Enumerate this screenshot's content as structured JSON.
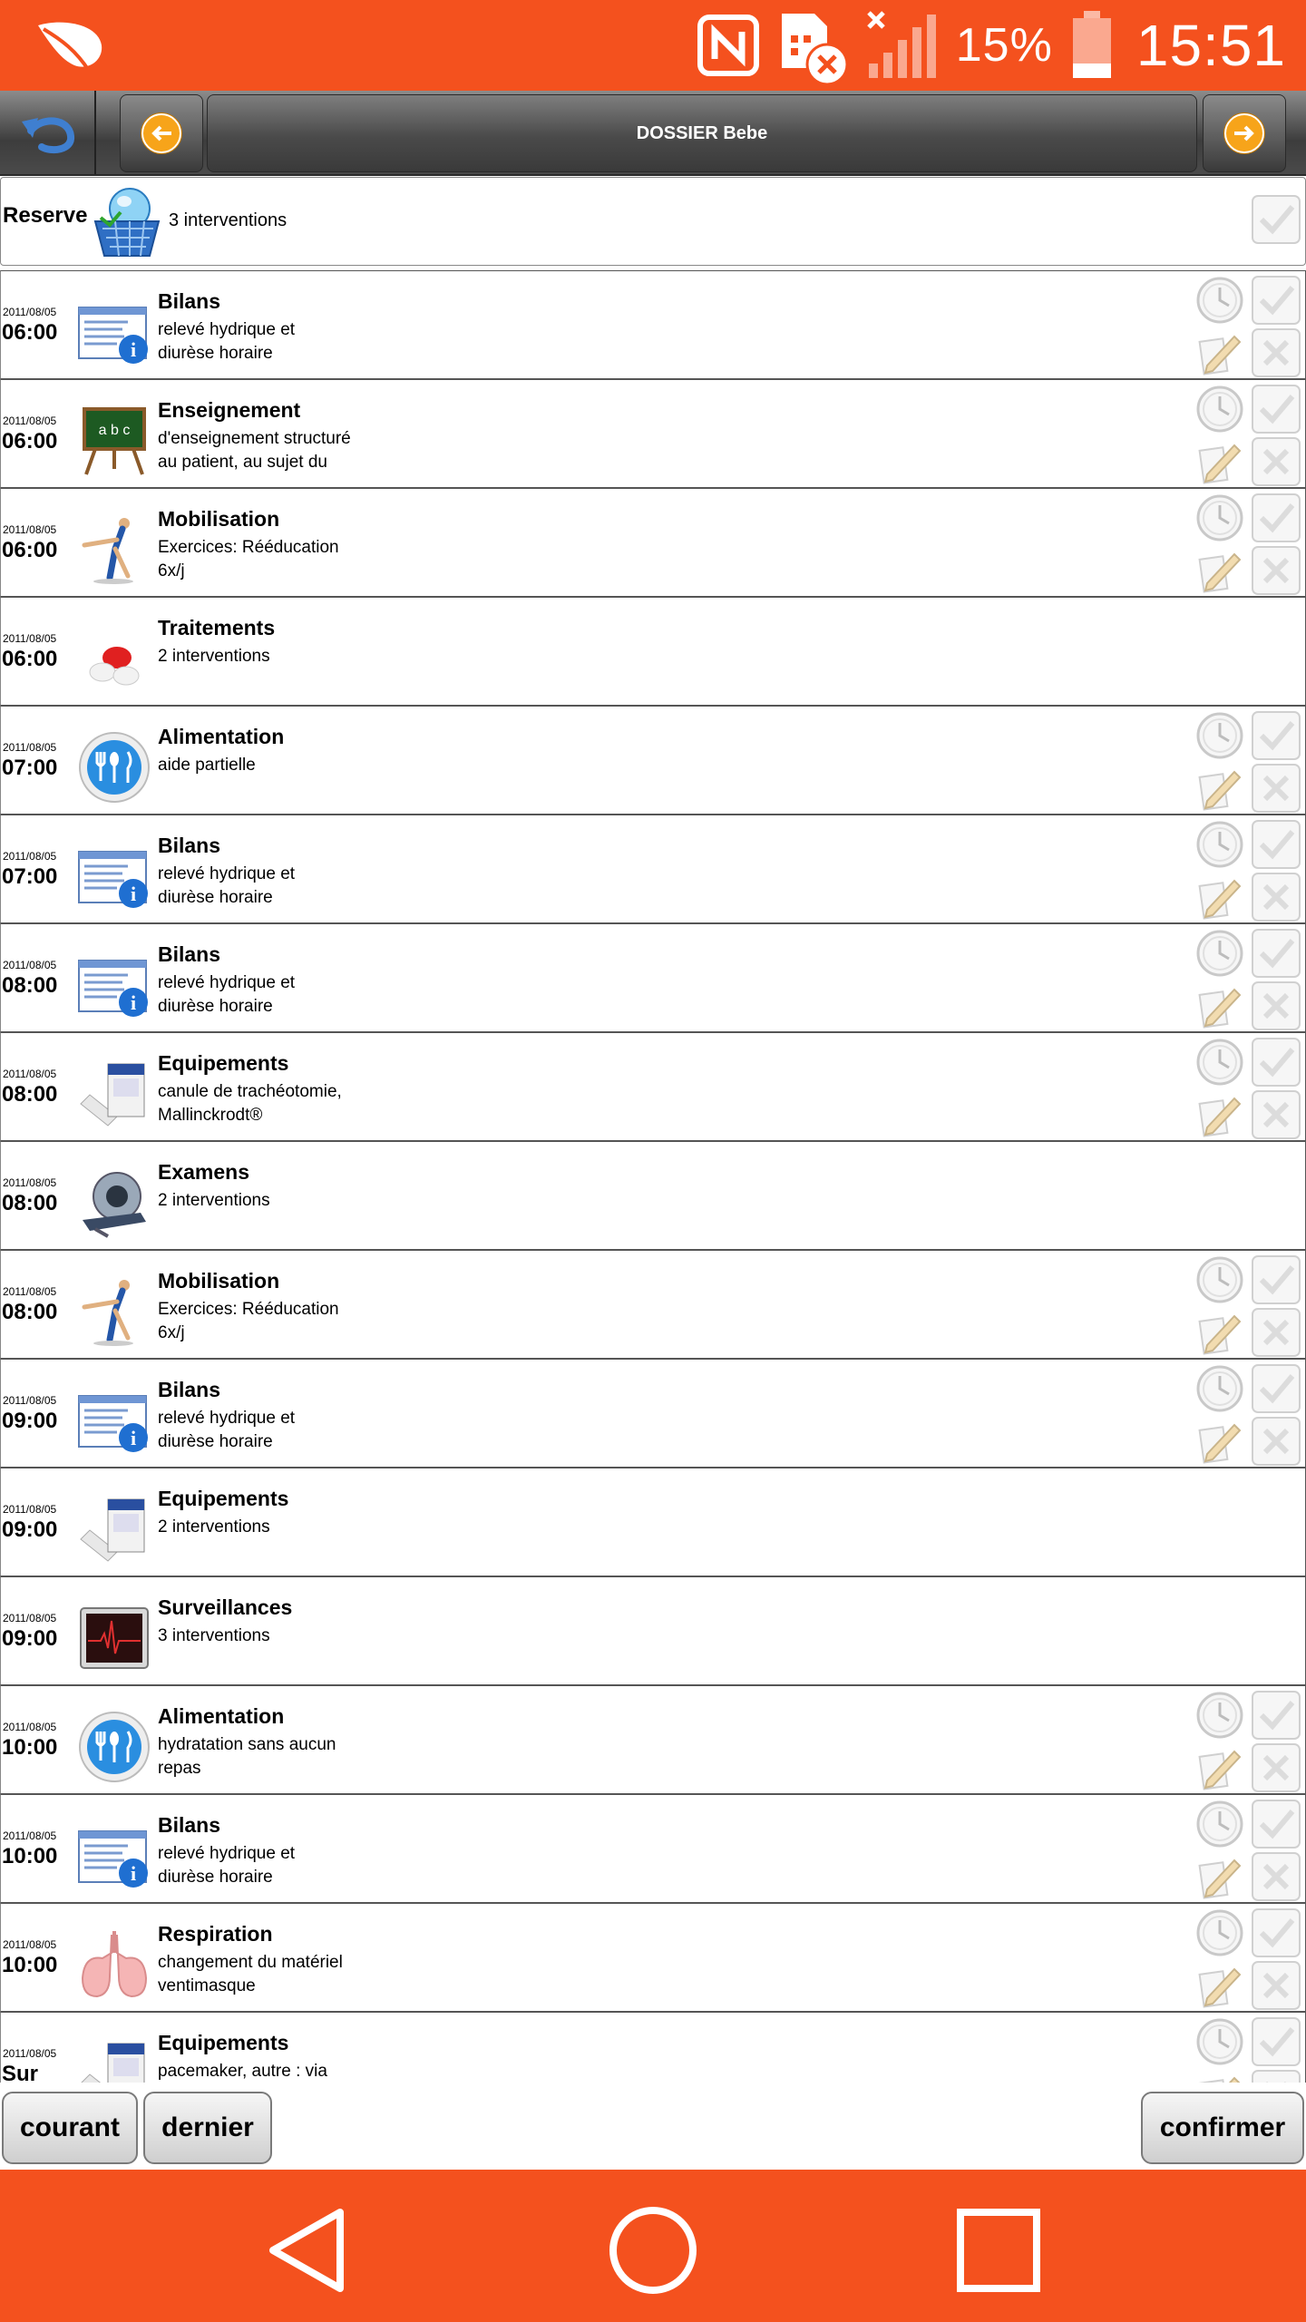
{
  "status_bar": {
    "battery_percent": "15%",
    "time": "15:51"
  },
  "toolbar": {
    "title": "DOSSIER Bebe"
  },
  "reserve": {
    "label": "Reserve",
    "count": "3 interventions"
  },
  "rows": [
    {
      "date": "2011/08/05",
      "time": "06:00",
      "title": "Bilans",
      "desc": [
        "relevé hydrique et",
        "diurèse horaire"
      ],
      "icon": "bilans-icon",
      "actions": true
    },
    {
      "date": "2011/08/05",
      "time": "06:00",
      "title": "Enseignement",
      "desc": [
        "d'enseignement structuré",
        "au patient, au sujet du"
      ],
      "icon": "enseignement-icon",
      "actions": true
    },
    {
      "date": "2011/08/05",
      "time": "06:00",
      "title": "Mobilisation",
      "desc": [
        "Exercices: Rééducation",
        "6x/j"
      ],
      "icon": "mobilisation-icon",
      "actions": true
    },
    {
      "date": "2011/08/05",
      "time": "06:00",
      "title": "Traitements",
      "desc": [
        "2 interventions"
      ],
      "icon": "traitements-icon",
      "actions": false
    },
    {
      "date": "2011/08/05",
      "time": "07:00",
      "title": "Alimentation",
      "desc": [
        "aide partielle"
      ],
      "icon": "alimentation-icon",
      "actions": true
    },
    {
      "date": "2011/08/05",
      "time": "07:00",
      "title": "Bilans",
      "desc": [
        "relevé hydrique et",
        "diurèse horaire"
      ],
      "icon": "bilans-icon",
      "actions": true
    },
    {
      "date": "2011/08/05",
      "time": "08:00",
      "title": "Bilans",
      "desc": [
        "relevé hydrique et",
        "diurèse horaire"
      ],
      "icon": "bilans-icon",
      "actions": true
    },
    {
      "date": "2011/08/05",
      "time": "08:00",
      "title": "Equipements",
      "desc": [
        "canule de trachéotomie,",
        "Mallinckrodt®"
      ],
      "icon": "equipements-icon",
      "actions": true
    },
    {
      "date": "2011/08/05",
      "time": "08:00",
      "title": "Examens",
      "desc": [
        "2 interventions"
      ],
      "icon": "examens-icon",
      "actions": false
    },
    {
      "date": "2011/08/05",
      "time": "08:00",
      "title": "Mobilisation",
      "desc": [
        "Exercices: Rééducation",
        "6x/j"
      ],
      "icon": "mobilisation-icon",
      "actions": true
    },
    {
      "date": "2011/08/05",
      "time": "09:00",
      "title": "Bilans",
      "desc": [
        "relevé hydrique et",
        "diurèse horaire"
      ],
      "icon": "bilans-icon",
      "actions": true
    },
    {
      "date": "2011/08/05",
      "time": "09:00",
      "title": "Equipements",
      "desc": [
        "2 interventions"
      ],
      "icon": "equipements-icon",
      "actions": false
    },
    {
      "date": "2011/08/05",
      "time": "09:00",
      "title": "Surveillances",
      "desc": [
        "3 interventions"
      ],
      "icon": "surveillances-icon",
      "actions": false
    },
    {
      "date": "2011/08/05",
      "time": "10:00",
      "title": "Alimentation",
      "desc": [
        "hydratation sans aucun",
        "repas"
      ],
      "icon": "alimentation-icon",
      "actions": true
    },
    {
      "date": "2011/08/05",
      "time": "10:00",
      "title": "Bilans",
      "desc": [
        "relevé hydrique et",
        "diurèse horaire"
      ],
      "icon": "bilans-icon",
      "actions": true
    },
    {
      "date": "2011/08/05",
      "time": "10:00",
      "title": "Respiration",
      "desc": [
        "changement du matériel",
        "ventimasque"
      ],
      "icon": "respiration-icon",
      "actions": true
    },
    {
      "date": "2011/08/05",
      "time": "Sur",
      "title": "Equipements",
      "desc": [
        "pacemaker, autre : via"
      ],
      "icon": "equipements-icon",
      "actions": true
    }
  ],
  "bottom": {
    "courant": "courant",
    "dernier": "dernier",
    "confirmer": "confirmer"
  }
}
